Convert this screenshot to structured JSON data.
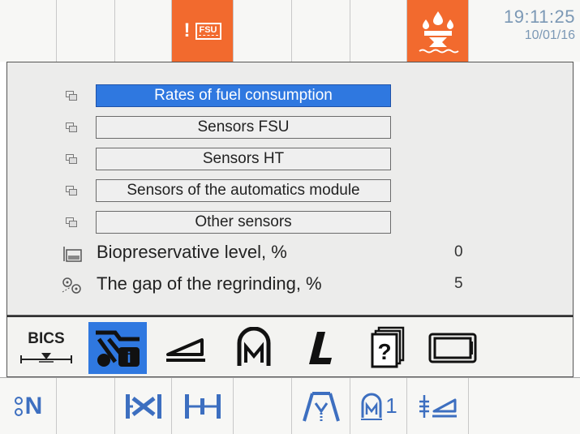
{
  "status": {
    "time": "19:11:25",
    "date": "10/01/16",
    "warning_icon": "fsu-warning-icon",
    "fuel_icon": "fuel-consumption-icon",
    "accent": "#f26a2e"
  },
  "menu": {
    "items": [
      {
        "label": "Rates of fuel consumption",
        "selected": true
      },
      {
        "label": "Sensors FSU"
      },
      {
        "label": "Sensors HT"
      },
      {
        "label": "Sensors of the automatics module"
      },
      {
        "label": "Other sensors"
      }
    ],
    "selected_color": "#2f78e0"
  },
  "info": [
    {
      "label": "Biopreservative level, %",
      "value": "0",
      "icon": "biopreservative-icon"
    },
    {
      "label": "The gap of the regrinding, %",
      "value": "5",
      "icon": "regrinding-gap-icon"
    }
  ],
  "toolbar": {
    "bics_label": "BICS",
    "items": [
      "bics-icon",
      "harvester-settings-icon",
      "header-angle-icon",
      "m-mode-icon",
      "l-mode-icon",
      "help-icon",
      "display-icon"
    ]
  },
  "bottom": {
    "n_label": "N",
    "m1_label": "1"
  }
}
